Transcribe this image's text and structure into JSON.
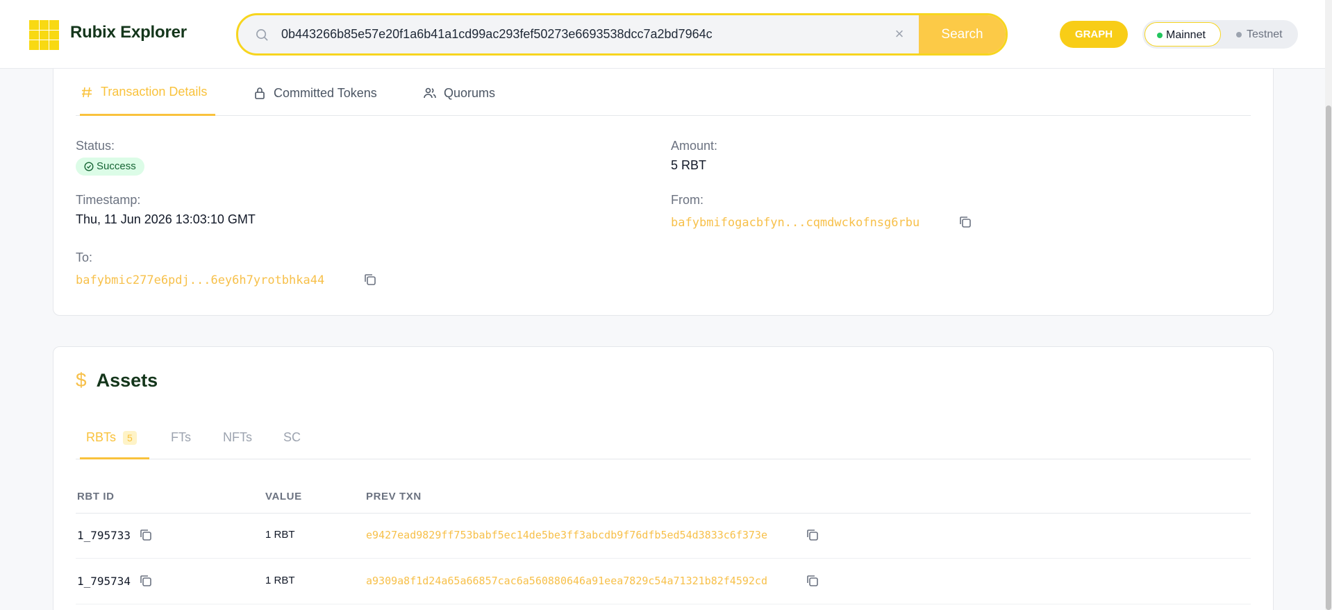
{
  "header": {
    "logo_text": "Rubix Explorer",
    "search_value": "0b443266b85e57e20f1a6b41a1cd99ac293fef50273e6693538dcc7a2bd7964c",
    "clear_label": "×",
    "search_button": "Search",
    "graph_button": "GRAPH",
    "network": {
      "mainnet": "Mainnet",
      "testnet": "Testnet",
      "selected": "Mainnet"
    }
  },
  "tx_tabs": [
    {
      "label": "Transaction Details",
      "icon": "hash-icon",
      "active": true
    },
    {
      "label": "Committed Tokens",
      "icon": "lock-icon",
      "active": false
    },
    {
      "label": "Quorums",
      "icon": "users-icon",
      "active": false
    }
  ],
  "details": {
    "status_label": "Status:",
    "status_value": "Success",
    "amount_label": "Amount:",
    "amount_value": "5 RBT",
    "timestamp_label": "Timestamp:",
    "timestamp_value": "Thu, 11 Jun 2026 13:03:10 GMT",
    "from_label": "From:",
    "from_value": "bafybmifogacbfyn...cqmdwckofnsg6rbu",
    "to_label": "To:",
    "to_value": "bafybmic277e6pdj...6ey6h7yrotbhka44"
  },
  "assets": {
    "title": "Assets",
    "tabs": [
      {
        "label": "RBTs",
        "count": "5",
        "active": true
      },
      {
        "label": "FTs",
        "active": false
      },
      {
        "label": "NFTs",
        "active": false
      },
      {
        "label": "SC",
        "active": false
      }
    ],
    "columns": [
      "RBT ID",
      "VALUE",
      "PREV TXN"
    ],
    "rows": [
      {
        "id": "1_795733",
        "value": "1 RBT",
        "prev": "e9427ead9829ff753babf5ec14de5be3ff3abcdb9f76dfb5ed54d3833c6f373e"
      },
      {
        "id": "1_795734",
        "value": "1 RBT",
        "prev": "a9309a8f1d24a65a66857cac6a560880646a91eea7829c54a71321b82f4592cd"
      }
    ]
  },
  "colors": {
    "accent": "#f9c23c",
    "brand_text": "#14361b",
    "success_bg": "#dcfce7",
    "success_text": "#166534"
  }
}
